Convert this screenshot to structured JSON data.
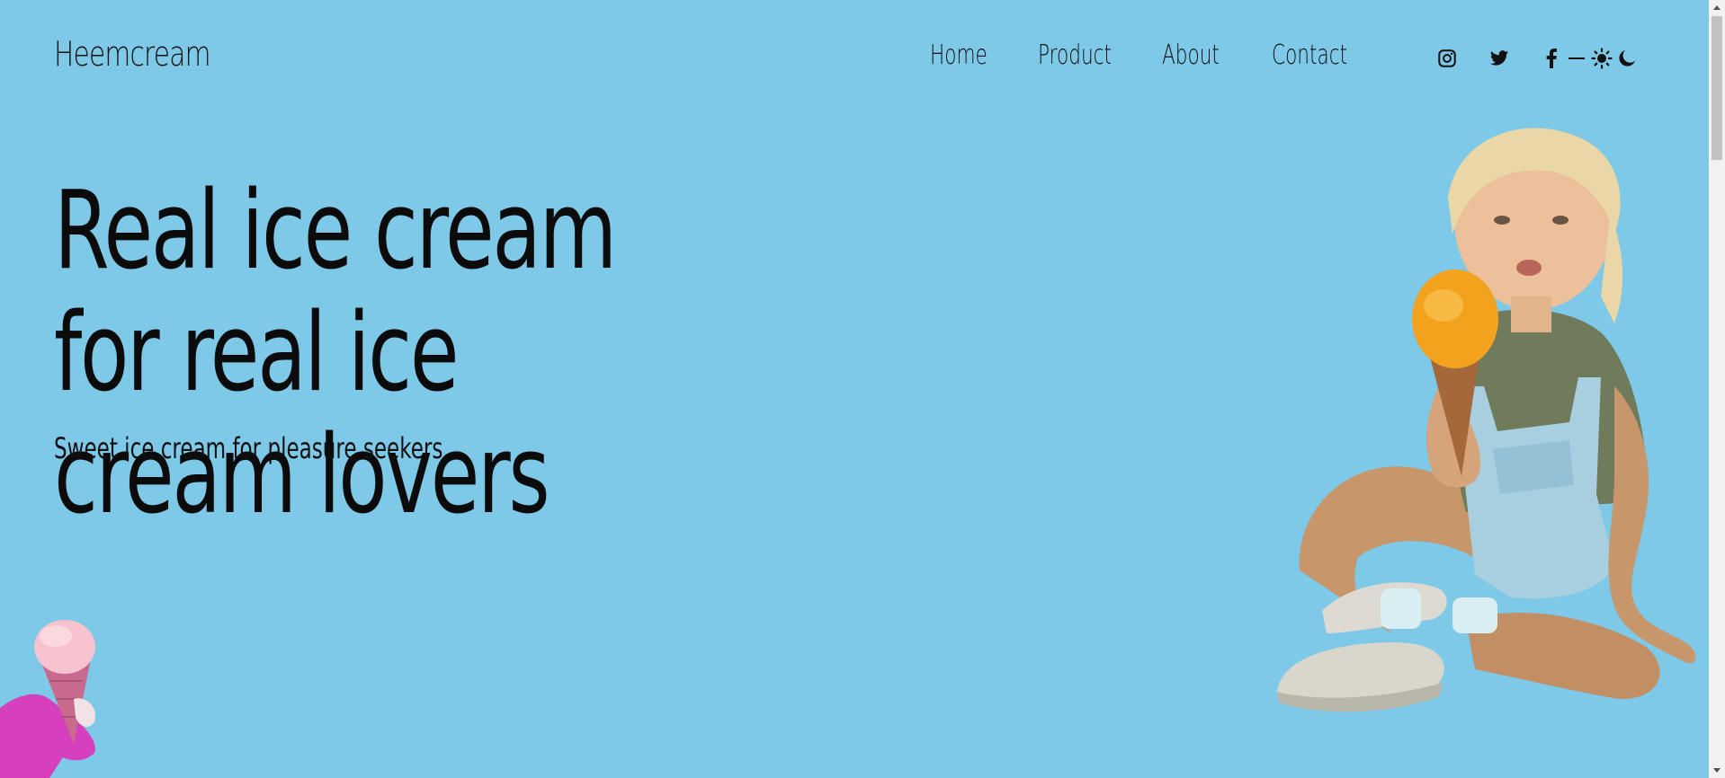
{
  "header": {
    "brand": "Heemcream",
    "nav": {
      "home": "Home",
      "product": "Product",
      "about": "About",
      "contact": "Contact"
    },
    "social_icons": [
      "instagram-icon",
      "twitter-icon",
      "facebook-icon"
    ],
    "theme_icons": [
      "sun-icon",
      "moon-icon"
    ]
  },
  "hero": {
    "title": "Real ice cream for real ice cream lovers",
    "subtitle": "Sweet ice cream for pleasure seekers."
  },
  "images": {
    "main": "child-with-ice-cream-photo",
    "corner": "pink-ice-cream-cone-photo"
  },
  "colors": {
    "background": "#7ec8e8",
    "text": "#111111"
  }
}
